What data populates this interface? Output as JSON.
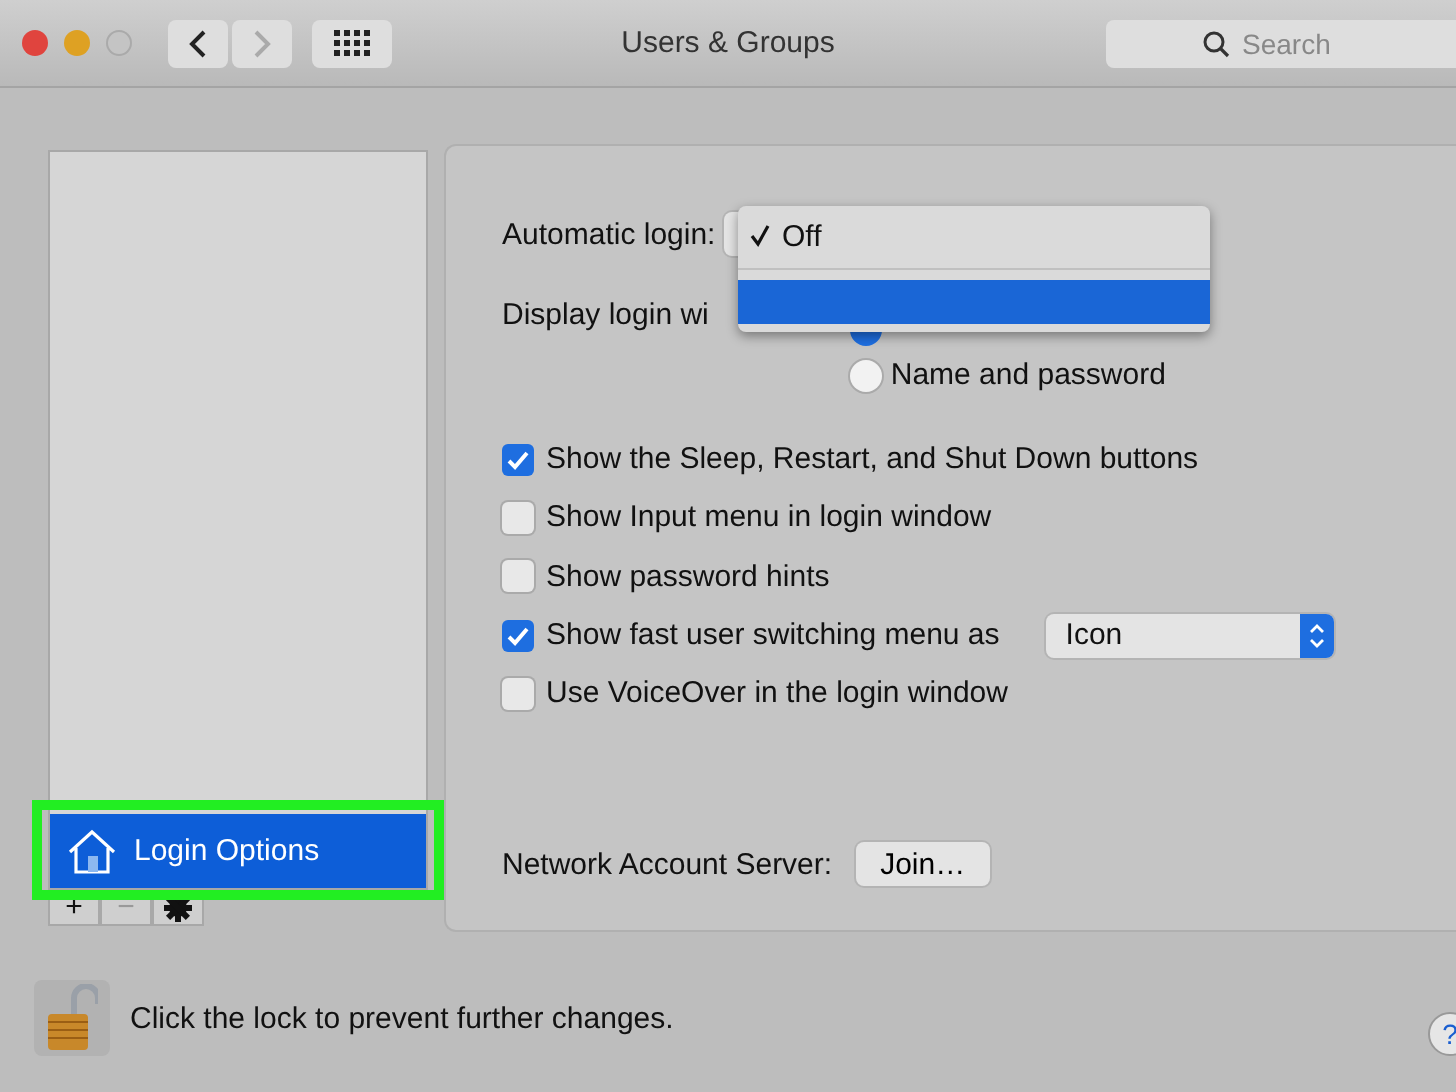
{
  "window": {
    "title": "Users & Groups",
    "search": {
      "placeholder": "Search"
    }
  },
  "sidebar": {
    "items": [
      {
        "label": "Login Options",
        "selected": true,
        "outlined": true
      }
    ],
    "buttons": [
      "+",
      "−"
    ]
  },
  "automatic_login": {
    "label": "Automatic login:",
    "menu": [
      {
        "kind": "item",
        "label": "Off",
        "checked": true,
        "selected": false
      },
      {
        "kind": "separator"
      },
      {
        "kind": "item",
        "selected": true
      }
    ]
  },
  "display_login_window": {
    "label": "Display login wi",
    "options": [
      {
        "selected": true
      },
      {
        "label": "Name and password",
        "selected": false
      }
    ]
  },
  "checkboxes": [
    {
      "label": "Show the Sleep, Restart, and Shut Down buttons",
      "checked": true
    },
    {
      "label": "Show Input menu in login window",
      "checked": false
    },
    {
      "label": "Show password hints",
      "checked": false
    },
    {
      "label": "Show fast user switching menu as",
      "checked": true,
      "popup": "Icon"
    },
    {
      "label": "Use VoiceOver in the login window",
      "checked": false
    }
  ],
  "network_account_server": {
    "label": "Network Account Server:",
    "button": "Join…"
  },
  "footer": {
    "lock_text": "Click the lock to prevent further changes.",
    "locked": false,
    "help": "?"
  }
}
